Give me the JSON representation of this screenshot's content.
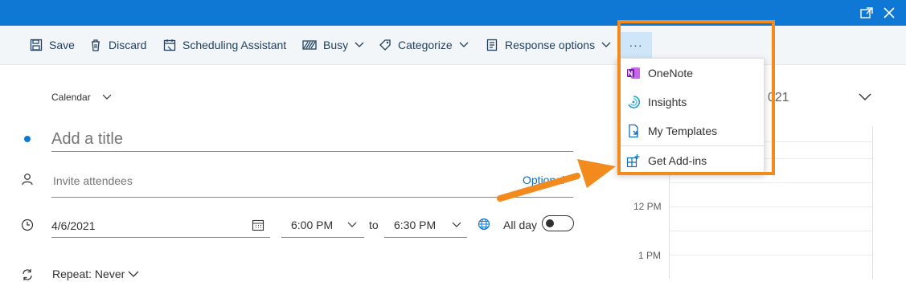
{
  "toolbar": {
    "save": "Save",
    "discard": "Discard",
    "scheduling": "Scheduling Assistant",
    "busy": "Busy",
    "categorize": "Categorize",
    "response": "Response options",
    "more": "···"
  },
  "form": {
    "calendar_label": "Calendar",
    "title_placeholder": "Add a title",
    "invite_placeholder": "Invite attendees",
    "optional_label": "Optional",
    "date_value": "4/6/2021",
    "start_time": "6:00 PM",
    "to_label": "to",
    "end_time": "6:30 PM",
    "allday_label": "All day",
    "repeat_label": "Repeat: Never"
  },
  "menu": {
    "items": [
      {
        "label": "OneNote",
        "icon": "onenote-icon"
      },
      {
        "label": "Insights",
        "icon": "insights-icon"
      },
      {
        "label": "My Templates",
        "icon": "templates-icon"
      },
      {
        "label": "Get Add-ins",
        "icon": "addins-icon"
      }
    ]
  },
  "calendar_panel": {
    "date_partial": "021",
    "hours": [
      "12 PM",
      "1 PM"
    ]
  },
  "colors": {
    "brand": "#0f78d4",
    "highlight": "#f28a1e"
  }
}
